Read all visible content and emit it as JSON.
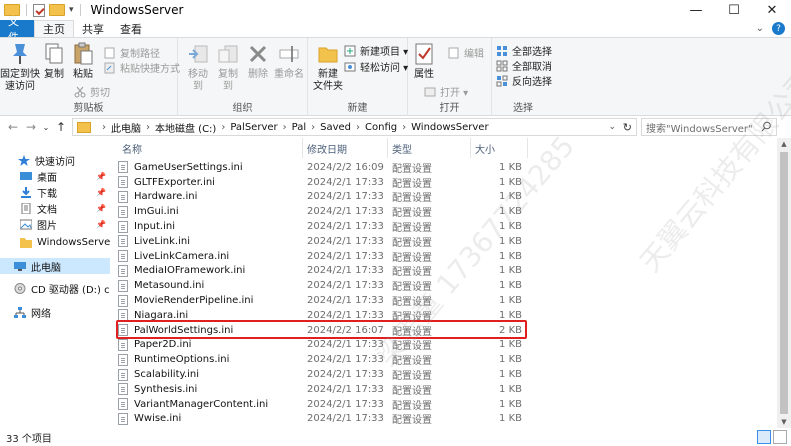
{
  "window": {
    "title": "WindowsServer",
    "minimize": "—",
    "maximize": "☐",
    "close": "✕"
  },
  "tabs": [
    "文件",
    "主页",
    "共享",
    "查看"
  ],
  "ribbon": {
    "clipboard": {
      "label": "剪贴板",
      "pin": "固定到快\n速访问",
      "copy": "复制",
      "paste": "粘贴",
      "cut": "剪切",
      "copy_path": "复制路径",
      "paste_shortcut": "粘贴快捷方式"
    },
    "organize": {
      "label": "组织",
      "move_to": "移动到",
      "copy_to": "复制到",
      "delete": "删除",
      "rename": "重命名"
    },
    "new": {
      "label": "新建",
      "new_folder": "新建\n文件夹",
      "new_item": "新建项目 ▾",
      "easy_access": "轻松访问 ▾"
    },
    "open": {
      "label": "打开",
      "properties": "属性",
      "open": "打开 ▾",
      "edit": "编辑"
    },
    "select": {
      "label": "选择",
      "select_all": "全部选择",
      "select_none": "全部取消",
      "invert": "反向选择"
    }
  },
  "address": {
    "crumbs": [
      "此电脑",
      "本地磁盘 (C:)",
      "PalServer",
      "Pal",
      "Saved",
      "Config",
      "WindowsServer"
    ],
    "search_placeholder": "搜索\"WindowsServer\""
  },
  "nav": {
    "items": [
      {
        "label": "快速访问",
        "icon": "star-icon"
      },
      {
        "label": "桌面",
        "icon": "desktop-icon",
        "pinned": true
      },
      {
        "label": "下载",
        "icon": "download-icon",
        "pinned": true
      },
      {
        "label": "文档",
        "icon": "document-icon",
        "pinned": true
      },
      {
        "label": "图片",
        "icon": "picture-icon",
        "pinned": true
      },
      {
        "label": "WindowsServer",
        "icon": "folder-icon"
      },
      {
        "label": "此电脑",
        "icon": "computer-icon",
        "selected": true
      },
      {
        "label": "CD 驱动器 (D:) conf",
        "icon": "cd-drive-icon"
      },
      {
        "label": "网络",
        "icon": "network-icon"
      }
    ]
  },
  "columns": {
    "name": "名称",
    "date": "修改日期",
    "type": "类型",
    "size": "大小"
  },
  "files": [
    {
      "name": "GameUserSettings.ini",
      "date": "2024/2/2 16:09",
      "type": "配置设置",
      "size": "1 KB"
    },
    {
      "name": "GLTFExporter.ini",
      "date": "2024/2/1 17:33",
      "type": "配置设置",
      "size": "1 KB"
    },
    {
      "name": "Hardware.ini",
      "date": "2024/2/1 17:33",
      "type": "配置设置",
      "size": "1 KB"
    },
    {
      "name": "ImGui.ini",
      "date": "2024/2/1 17:33",
      "type": "配置设置",
      "size": "1 KB"
    },
    {
      "name": "Input.ini",
      "date": "2024/2/1 17:33",
      "type": "配置设置",
      "size": "1 KB"
    },
    {
      "name": "LiveLink.ini",
      "date": "2024/2/1 17:33",
      "type": "配置设置",
      "size": "1 KB"
    },
    {
      "name": "LiveLinkCamera.ini",
      "date": "2024/2/1 17:33",
      "type": "配置设置",
      "size": "1 KB"
    },
    {
      "name": "MediaIOFramework.ini",
      "date": "2024/2/1 17:33",
      "type": "配置设置",
      "size": "1 KB"
    },
    {
      "name": "Metasound.ini",
      "date": "2024/2/1 17:33",
      "type": "配置设置",
      "size": "1 KB"
    },
    {
      "name": "MovieRenderPipeline.ini",
      "date": "2024/2/1 17:33",
      "type": "配置设置",
      "size": "1 KB"
    },
    {
      "name": "Niagara.ini",
      "date": "2024/2/1 17:33",
      "type": "配置设置",
      "size": "1 KB"
    },
    {
      "name": "PalWorldSettings.ini",
      "date": "2024/2/2 16:07",
      "type": "配置设置",
      "size": "2 KB",
      "highlighted": true
    },
    {
      "name": "Paper2D.ini",
      "date": "2024/2/1 17:33",
      "type": "配置设置",
      "size": "1 KB"
    },
    {
      "name": "RuntimeOptions.ini",
      "date": "2024/2/1 17:33",
      "type": "配置设置",
      "size": "1 KB"
    },
    {
      "name": "Scalability.ini",
      "date": "2024/2/1 17:33",
      "type": "配置设置",
      "size": "1 KB"
    },
    {
      "name": "Synthesis.ini",
      "date": "2024/2/1 17:33",
      "type": "配置设置",
      "size": "1 KB"
    },
    {
      "name": "VariantManagerContent.ini",
      "date": "2024/2/1 17:33",
      "type": "配置设置",
      "size": "1 KB"
    },
    {
      "name": "Wwise.ini",
      "date": "2024/2/1 17:33",
      "type": "配置设置",
      "size": "1 KB"
    }
  ],
  "status": {
    "item_count": "33 个项目"
  },
  "colors": {
    "accent": "#1979ca",
    "highlight": "#e02020",
    "selected_nav": "#cce8ff",
    "folder": "#f3c24c"
  },
  "watermark": [
    "天翼云科技有限公司",
    "梁思童 17367724285"
  ]
}
